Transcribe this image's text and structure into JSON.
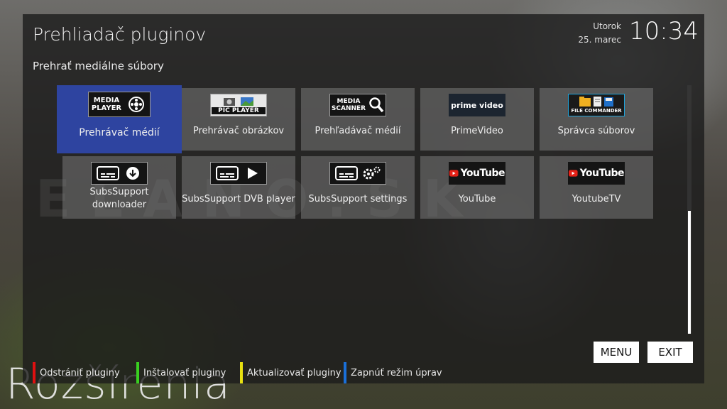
{
  "header": {
    "title": "Prehliadač pluginov",
    "subtitle": "Prehrať mediálne súbory",
    "day": "Utorok",
    "date": "25. marec",
    "time": "10:34"
  },
  "background_title": "Rozšírenia",
  "watermark": "ELANO.SK",
  "plugins": [
    {
      "label": "Prehrávač médií",
      "logo_lines": [
        "MEDIA",
        "PLAYER"
      ],
      "selected": true
    },
    {
      "label": "Prehrávač obrázkov",
      "logo_lines": [
        "PIC PLAYER"
      ]
    },
    {
      "label": "Prehľadávač médií",
      "logo_lines": [
        "MEDIA",
        "SCANNER"
      ]
    },
    {
      "label": "PrimeVideo",
      "logo_lines": [
        "prime video"
      ]
    },
    {
      "label": "Správca súborov",
      "logo_lines": [
        "FILE COMMANDER"
      ]
    },
    {
      "label": "SubsSupport downloader"
    },
    {
      "label": "SubsSupport DVB player"
    },
    {
      "label": "SubsSupport settings"
    },
    {
      "label": "YouTube",
      "logo_lines": [
        "YouTube"
      ]
    },
    {
      "label": "YoutubeTV",
      "logo_lines": [
        "YouTube"
      ]
    }
  ],
  "buttons": {
    "menu": "MENU",
    "exit": "EXIT"
  },
  "color_keys": [
    {
      "label": "Odstrániť pluginy",
      "color": "#e01010"
    },
    {
      "label": "Inštalovať pluginy",
      "color": "#39d020"
    },
    {
      "label": "Aktualizovať pluginy",
      "color": "#e8e010"
    },
    {
      "label": "Zapnúť režim úprav",
      "color": "#1a6fd8"
    }
  ],
  "colors": {
    "selection": "#2e44a0",
    "youtube_red": "#e62117",
    "prime_blue": "#1fa4dc"
  }
}
